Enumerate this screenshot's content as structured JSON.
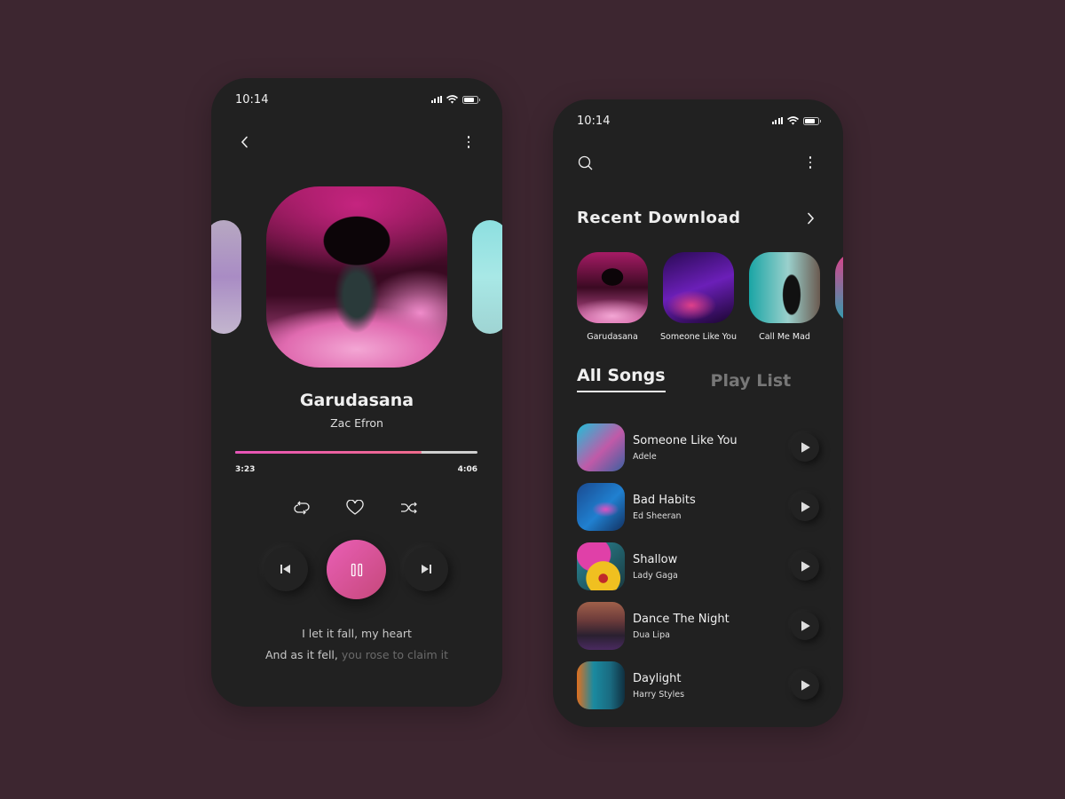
{
  "player": {
    "status_time": "10:14",
    "song_title": "Garudasana",
    "artist": "Zac Efron",
    "current_time": "3:23",
    "total_time": "4:06",
    "progress_fraction": 0.77,
    "lyrics": {
      "line1": "I let it fall, my heart",
      "line2_sung": "And as it fell,",
      "line2_upcoming": " you rose to claim it"
    },
    "icons": {
      "back": "chevron-left-icon",
      "more": "more-vertical-icon",
      "repeat": "repeat-icon",
      "like": "heart-icon",
      "shuffle": "shuffle-icon",
      "prev": "skip-previous-icon",
      "pause": "pause-icon",
      "next": "skip-next-icon"
    },
    "accent_gradient": [
      "#ea5fb6",
      "#c5487a"
    ]
  },
  "library": {
    "status_time": "10:14",
    "section_title": "Recent Download",
    "recent": [
      {
        "label": "Garudasana"
      },
      {
        "label": "Someone Like You"
      },
      {
        "label": "Call Me Mad"
      },
      {
        "label": ""
      }
    ],
    "tabs": [
      {
        "label": "All Songs",
        "active": true
      },
      {
        "label": "Play List",
        "active": false
      }
    ],
    "songs": [
      {
        "title": "Someone Like You",
        "artist": "Adele"
      },
      {
        "title": "Bad Habits",
        "artist": "Ed Sheeran"
      },
      {
        "title": "Shallow",
        "artist": "Lady Gaga"
      },
      {
        "title": "Dance The Night",
        "artist": "Dua Lipa"
      },
      {
        "title": "Daylight",
        "artist": "Harry Styles"
      }
    ]
  },
  "colors": {
    "background": "#3d2630",
    "phone_bg": "#212121",
    "accent": "#e754b8"
  }
}
